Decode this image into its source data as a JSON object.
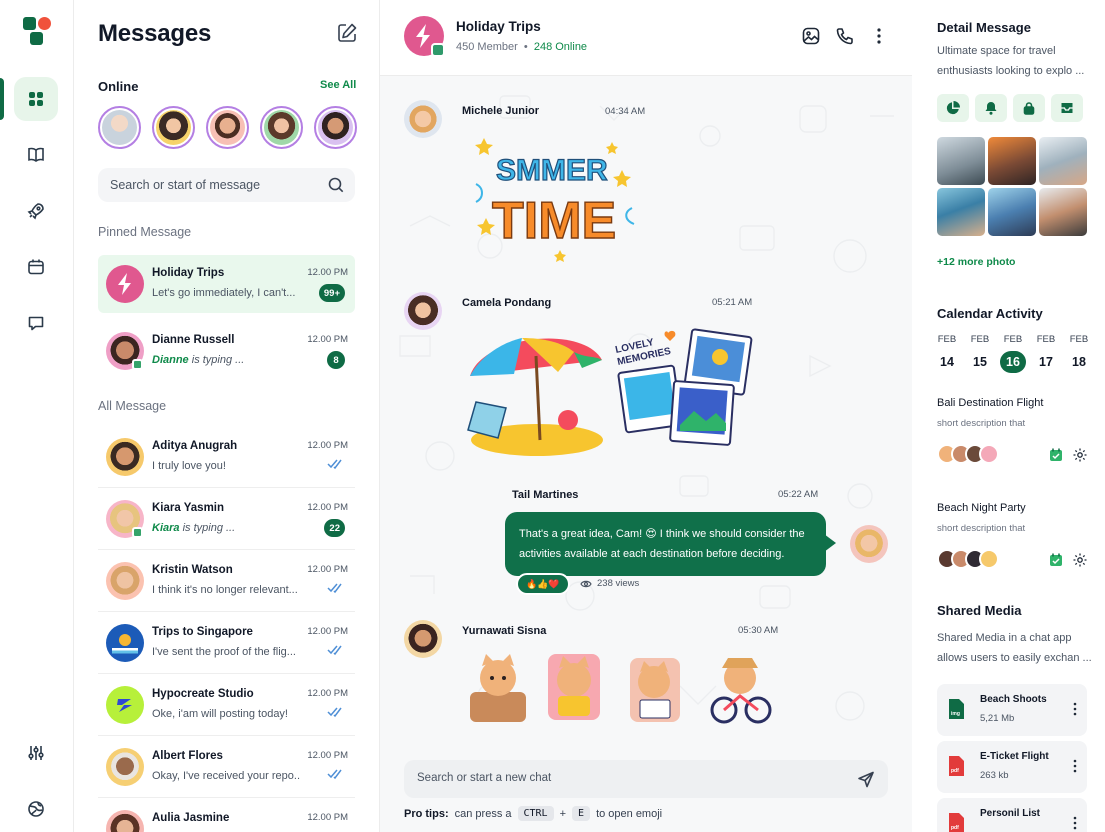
{
  "messages_panel": {
    "title": "Messages",
    "online_label": "Online",
    "see_all": "See All",
    "search_placeholder": "Search or start of message",
    "pinned_label": "Pinned Message",
    "all_label": "All Message",
    "pinned": [
      {
        "name": "Holiday Trips",
        "preview": "Let's go immediately, I can't...",
        "time": "12.00 PM",
        "count": "99+"
      },
      {
        "name": "Dianne Russell",
        "typing_name": "Dianne",
        "typing_text": "is typing ...",
        "time": "12.00 PM",
        "count": "8"
      }
    ],
    "all": [
      {
        "name": "Aditya Anugrah",
        "preview": "I truly love you!",
        "time": "12.00 PM"
      },
      {
        "name": "Kiara Yasmin",
        "typing_name": "Kiara",
        "typing_text": "is typing ...",
        "time": "12.00 PM",
        "count": "22"
      },
      {
        "name": "Kristin Watson",
        "preview": "I think it's no longer relevant...",
        "time": "12.00 PM"
      },
      {
        "name": "Trips to Singapore",
        "preview": "I've sent the proof of the flig...",
        "time": "12.00 PM"
      },
      {
        "name": "Hypocreate Studio",
        "preview": "Oke, i'am will posting today!",
        "time": "12.00 PM"
      },
      {
        "name": "Albert Flores",
        "preview": "Okay, I've received your repo...",
        "time": "12.00 PM"
      },
      {
        "name": "Aulia Jasmine",
        "preview": "",
        "time": "12.00 PM"
      }
    ]
  },
  "chat": {
    "group_name": "Holiday Trips",
    "members": "450 Member",
    "online": "248 Online",
    "messages": [
      {
        "sender": "Michele Junior",
        "time": "04:34 AM",
        "sticker": "SUMMER TIME"
      },
      {
        "sender": "Camela Pondang",
        "time": "05:21 AM",
        "sticker": "LOVELY MEMORIES"
      },
      {
        "sender": "Tail Martines",
        "time": "05:22 AM",
        "text": "That's a great idea, Cam! 😍 I think we should consider the activities available at each destination before deciding.",
        "reactions": "🔥👍❤️",
        "views": "238 views"
      },
      {
        "sender": "Yurnawati Sisna",
        "time": "05:30 AM"
      }
    ],
    "input_placeholder": "Search or start a new chat",
    "tips_label": "Pro tips:",
    "tips_text1": "can press a",
    "tips_key1": "CTRL",
    "tips_plus": "+",
    "tips_key2": "E",
    "tips_text2": "to open emoji"
  },
  "detail": {
    "title": "Detail Message",
    "description": "Ultimate space for travel enthusiasts looking to explo ...",
    "more_photo": "+12 more photo",
    "calendar_title": "Calendar Activity",
    "calendar": [
      {
        "month": "FEB",
        "day": "14"
      },
      {
        "month": "FEB",
        "day": "15"
      },
      {
        "month": "FEB",
        "day": "16",
        "selected": true
      },
      {
        "month": "FEB",
        "day": "17"
      },
      {
        "month": "FEB",
        "day": "18"
      }
    ],
    "events": [
      {
        "title": "Bali Destination Flight",
        "desc": "short description that"
      },
      {
        "title": "Beach Night Party",
        "desc": "short description that"
      }
    ],
    "shared_title": "Shared Media",
    "shared_desc": "Shared Media in a chat app allows users to easily exchan ...",
    "files": [
      {
        "name": "Beach Shoots",
        "size": "5,21 Mb",
        "type": "img",
        "color": "#0f6b45"
      },
      {
        "name": "E-Ticket Flight",
        "size": "263 kb",
        "type": "pdf",
        "color": "#e23b3b"
      },
      {
        "name": "Personil List",
        "size": "",
        "type": "pdf",
        "color": "#e23b3b"
      }
    ]
  },
  "colors": {
    "brand": "#0f6b45",
    "accent_green": "#0f8a4a",
    "pinned_bg": "#e9f8ed",
    "check_blue": "#4f8fd6"
  },
  "icons": [
    "app-logo-icon",
    "grid-icon",
    "book-icon",
    "rocket-icon",
    "calendar-icon",
    "chat-icon",
    "sliders-icon",
    "globe-icon",
    "compose-icon",
    "search-icon",
    "image-icon",
    "phone-icon",
    "more-vertical-icon",
    "send-icon",
    "pie-chart-icon",
    "bell-icon",
    "lock-icon",
    "inbox-icon",
    "gear-icon",
    "file-icon"
  ]
}
